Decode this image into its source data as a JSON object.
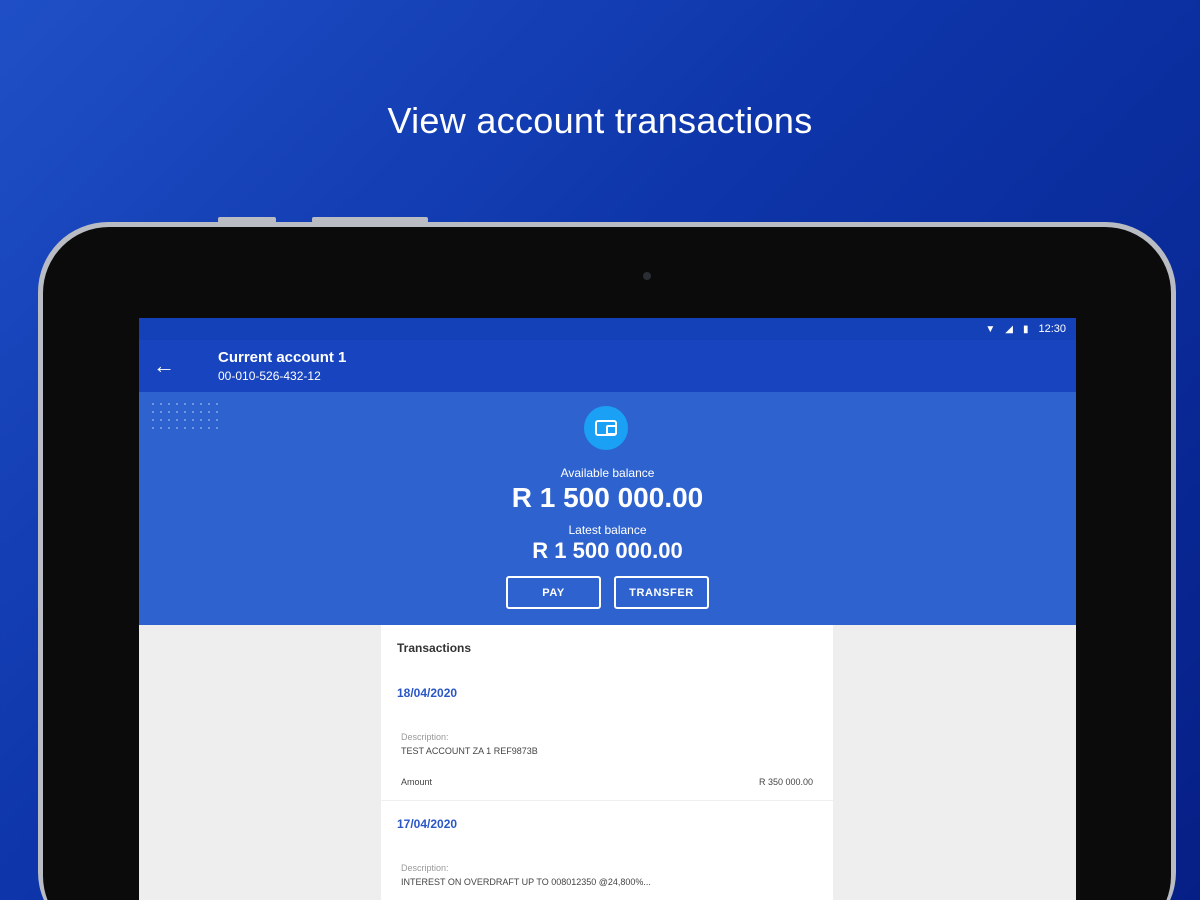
{
  "headline": "View account transactions",
  "status_bar": {
    "time": "12:30"
  },
  "app_bar": {
    "account_name": "Current account 1",
    "account_number": "00-010-526-432-12"
  },
  "balance": {
    "available_label": "Available balance",
    "available_amount": "R 1 500 000.00",
    "latest_label": "Latest balance",
    "latest_amount": "R 1 500 000.00",
    "pay_label": "PAY",
    "transfer_label": "TRANSFER"
  },
  "transactions": {
    "heading": "Transactions",
    "items": [
      {
        "date": "18/04/2020",
        "description_label": "Description:",
        "description": "TEST ACCOUNT ZA 1 REF9873B",
        "amount_label": "Amount",
        "amount": "R 350 000.00"
      },
      {
        "date": "17/04/2020",
        "description_label": "Description:",
        "description": "INTEREST ON OVERDRAFT UP TO 008012350 @24,800%..."
      }
    ]
  }
}
